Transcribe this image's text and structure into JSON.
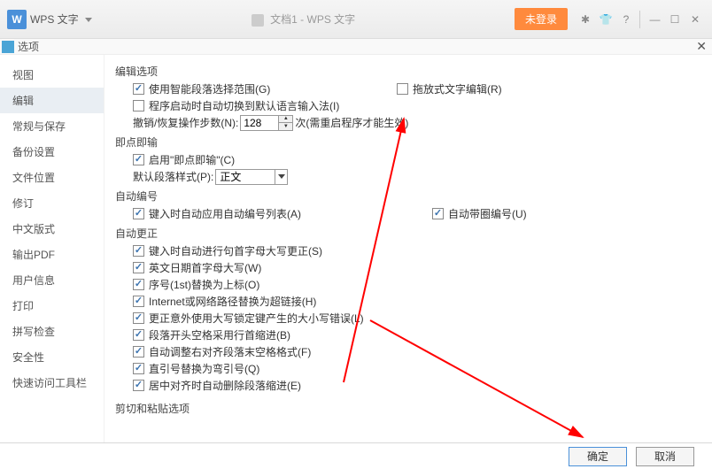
{
  "titlebar": {
    "app_name": "WPS 文字",
    "doc_title": "文档1 - WPS 文字",
    "login_label": "未登录"
  },
  "dialog": {
    "title": "选项"
  },
  "sidebar": {
    "items": [
      {
        "label": "视图"
      },
      {
        "label": "编辑"
      },
      {
        "label": "常规与保存"
      },
      {
        "label": "备份设置"
      },
      {
        "label": "文件位置"
      },
      {
        "label": "修订"
      },
      {
        "label": "中文版式"
      },
      {
        "label": "输出PDF"
      },
      {
        "label": "用户信息"
      },
      {
        "label": "打印"
      },
      {
        "label": "拼写检查"
      },
      {
        "label": "安全性"
      },
      {
        "label": "快速访问工具栏"
      }
    ],
    "active_index": 1
  },
  "sections": {
    "edit_options": {
      "title": "编辑选项",
      "smart_paragraph": "使用智能段落选择范围(G)",
      "drag_drop_edit": "拖放式文字编辑(R)",
      "auto_switch_ime": "程序启动时自动切换到默认语言输入法(I)",
      "undo_label_pre": "撤销/恢复操作步数(N):",
      "undo_value": "128",
      "undo_label_post": "次(需重启程序才能生效)"
    },
    "click_type": {
      "title": "即点即输",
      "enable": "启用\"即点即输\"(C)",
      "default_style_label": "默认段落样式(P):",
      "default_style_value": "正文"
    },
    "auto_number": {
      "title": "自动编号",
      "apply_on_type": "键入时自动应用自动编号列表(A)",
      "circled": "自动带圈编号(U)"
    },
    "auto_correct": {
      "title": "自动更正",
      "items": [
        "键入时自动进行句首字母大写更正(S)",
        "英文日期首字母大写(W)",
        "序号(1st)替换为上标(O)",
        "Internet或网络路径替换为超链接(H)",
        "更正意外使用大写锁定键产生的大小写错误(L)",
        "段落开头空格采用行首缩进(B)",
        "自动调整右对齐段落末空格格式(F)",
        "直引号替换为弯引号(Q)",
        "居中对齐时自动删除段落缩进(E)"
      ]
    },
    "cut_paste": {
      "title": "剪切和粘贴选项"
    }
  },
  "footer": {
    "ok": "确定",
    "cancel": "取消"
  }
}
